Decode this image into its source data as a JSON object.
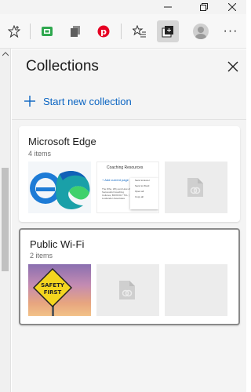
{
  "window": {
    "minimize_icon": "minimize-icon",
    "restore_icon": "restore-icon",
    "close_icon": "window-close-icon"
  },
  "toolbar": {
    "items": [
      {
        "icon": "favorite-star-icon"
      },
      {
        "icon": "green-extension-icon"
      },
      {
        "icon": "stack-extension-icon"
      },
      {
        "icon": "pinterest-icon"
      },
      {
        "icon": "favorites-list-icon"
      },
      {
        "icon": "collections-icon",
        "active": true
      },
      {
        "icon": "profile-avatar"
      },
      {
        "icon": "more-options-icon",
        "label": "···"
      }
    ]
  },
  "collections": {
    "title": "Collections",
    "new_collection_label": "Start new collection",
    "list": [
      {
        "title": "Microsoft Edge",
        "count": "4 items",
        "thumbnails": [
          "edge-logos",
          "coaching-resources-page",
          "placeholder"
        ],
        "coaching": {
          "title": "Coaching Resources",
          "add_link": "+ Add current page",
          "body": "The Who, Why and How of Successful Coaching Cultures, BOXFOLT TCL | Lowlander Associates",
          "menu": [
            "Send to Excel",
            "Send to Word",
            "Open all",
            "Copy all"
          ]
        }
      },
      {
        "title": "Public Wi-Fi",
        "count": "2 items",
        "thumbnails": [
          "safety-first-sign",
          "placeholder",
          "empty"
        ],
        "selected": true,
        "sign_text": [
          "SAFETY",
          "FIRST"
        ]
      }
    ]
  },
  "colors": {
    "accent": "#0a64c2",
    "pinterest": "#e60023",
    "extension_green": "#2fa84f",
    "selected_border": "#8a8a8a"
  }
}
